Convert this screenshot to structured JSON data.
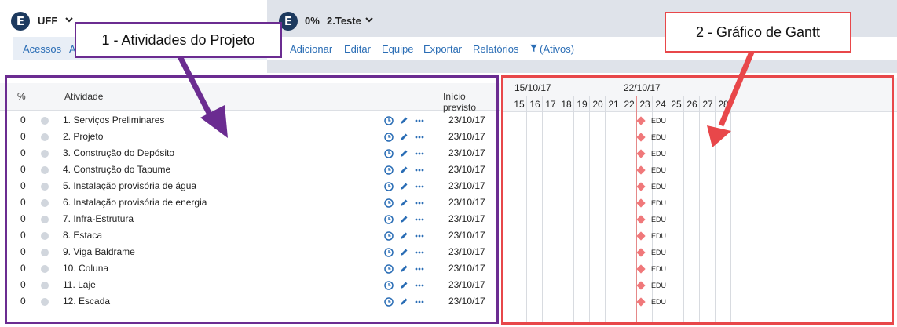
{
  "left_header": {
    "org": "UFF",
    "nav_link": "Acessos",
    "nav_link2_initial": "A"
  },
  "project_header": {
    "percent": "0%",
    "project": "2.Teste"
  },
  "toolbar": [
    "Adicionar",
    "Editar",
    "Equipe",
    "Exportar",
    "Relatórios",
    "(Ativos)"
  ],
  "table": {
    "headers": {
      "pct": "%",
      "activity": "Atividade",
      "start": "Início previsto"
    },
    "rows": [
      {
        "pct": "0",
        "name": "1. Serviços Preliminares",
        "start": "23/10/17"
      },
      {
        "pct": "0",
        "name": "2. Projeto",
        "start": "23/10/17"
      },
      {
        "pct": "0",
        "name": "3. Construção do Depósito",
        "start": "23/10/17"
      },
      {
        "pct": "0",
        "name": "4. Construção do Tapume",
        "start": "23/10/17"
      },
      {
        "pct": "0",
        "name": "5. Instalação provisória de água",
        "start": "23/10/17"
      },
      {
        "pct": "0",
        "name": "6. Instalação provisória de energia",
        "start": "23/10/17"
      },
      {
        "pct": "0",
        "name": "7. Infra-Estrutura",
        "start": "23/10/17"
      },
      {
        "pct": "0",
        "name": "8. Estaca",
        "start": "23/10/17"
      },
      {
        "pct": "0",
        "name": "9. Viga Baldrame",
        "start": "23/10/17"
      },
      {
        "pct": "0",
        "name": "10. Coluna",
        "start": "23/10/17"
      },
      {
        "pct": "0",
        "name": "11. Laje",
        "start": "23/10/17"
      },
      {
        "pct": "0",
        "name": "12. Escada",
        "start": "23/10/17"
      }
    ],
    "row_icons": [
      "clock-icon",
      "pencil-icon",
      "more-icon"
    ]
  },
  "gantt": {
    "weeks": [
      "15/10/17",
      "22/10/17"
    ],
    "days": [
      "15",
      "16",
      "17",
      "18",
      "19",
      "20",
      "21",
      "22",
      "23",
      "24",
      "25",
      "26",
      "27",
      "28"
    ],
    "milestone_label": "EDU"
  },
  "annotations": {
    "callout1": "1 - Atividades do Projeto",
    "callout2": "2 - Gráfico de Gantt"
  },
  "colors": {
    "accent_link": "#2a6db5",
    "annotation_purple": "#6b2c91",
    "annotation_red": "#e8474a",
    "milestone": "#f0787a"
  }
}
